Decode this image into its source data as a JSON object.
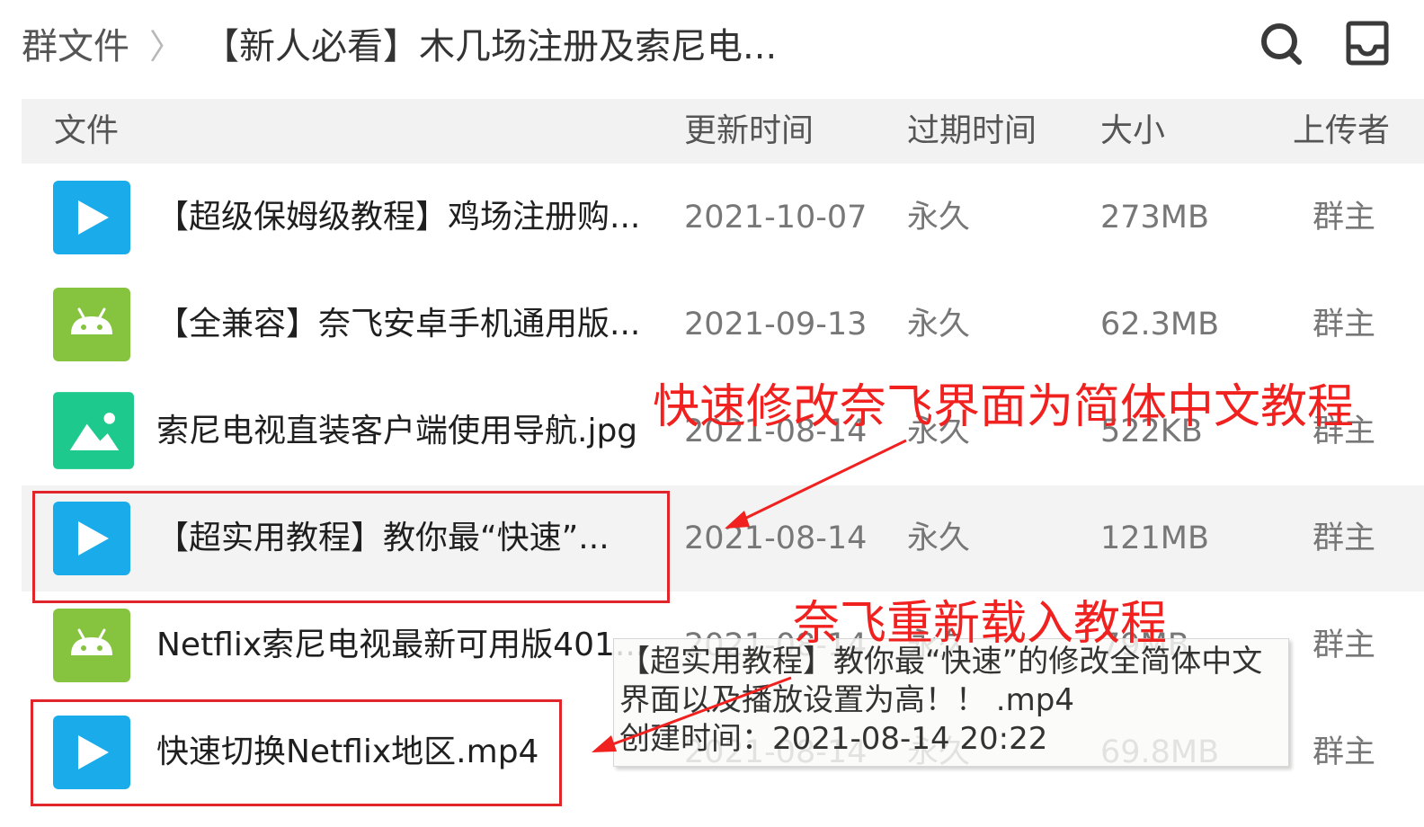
{
  "breadcrumb": {
    "root": "群文件",
    "separator": "〉",
    "current": "【新人必看】木几场注册及索尼电..."
  },
  "toolbar": {
    "search_icon": "search-icon",
    "inbox_icon": "inbox-tray-icon"
  },
  "columns": {
    "file": "文件",
    "updated": "更新时间",
    "expires": "过期时间",
    "size": "大小",
    "uploader": "上传者"
  },
  "files": [
    {
      "icon": "video-play-icon",
      "icon_color": "#1aabeb",
      "name": "【超级保姆级教程】鸡场注册购...",
      "date": "2021-10-07",
      "expires": "永久",
      "size": "273MB",
      "uploader": "群主"
    },
    {
      "icon": "android-icon",
      "icon_color": "#86c440",
      "name": "【全兼容】奈飞安卓手机通用版...",
      "date": "2021-09-13",
      "expires": "永久",
      "size": "62.3MB",
      "uploader": "群主"
    },
    {
      "icon": "image-icon",
      "icon_color": "#1ec98e",
      "name": "索尼电视直装客户端使用导航.jpg",
      "date": "2021-08-14",
      "expires": "永久",
      "size": "522KB",
      "uploader": "群主"
    },
    {
      "icon": "video-play-icon",
      "icon_color": "#1aabeb",
      "name": "【超实用教程】教你最“快速”...",
      "date": "2021-08-14",
      "expires": "永久",
      "size": "121MB",
      "uploader": "群主"
    },
    {
      "icon": "android-icon",
      "icon_color": "#86c440",
      "name": "Netflix索尼电视最新可用版401...",
      "date": "2021-08-14",
      "expires": "永久",
      "size": "79MB",
      "uploader": "群主"
    },
    {
      "icon": "video-play-icon",
      "icon_color": "#1aabeb",
      "name": "快速切换Netflix地区.mp4",
      "date": "2021-08-14",
      "expires": "永久",
      "size": "69.8MB",
      "uploader": "群主"
    }
  ],
  "annotations": {
    "label_1": "快速修改奈飞界面为简体中文教程",
    "label_2": "奈飞重新载入教程",
    "color": "#f0211f"
  },
  "tooltip": {
    "line1": "【超实用教程】教你最“快速”的修改全简体中文",
    "line2": "界面以及播放设置为高！！ .mp4",
    "line3": "创建时间：2021-08-14 20:22"
  }
}
